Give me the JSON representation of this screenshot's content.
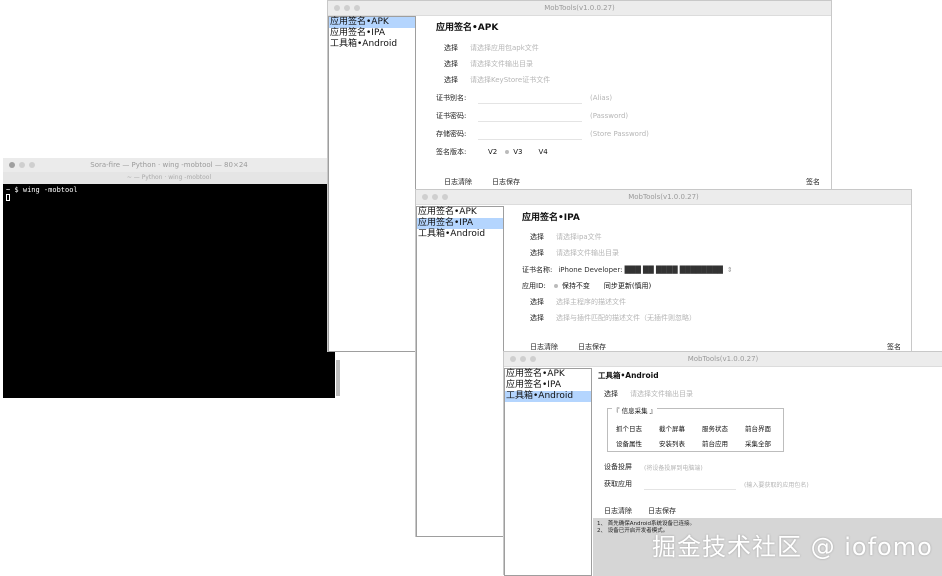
{
  "terminal": {
    "title": "Sora-fire — Python · wing -mobtool — 80×24",
    "subtitle": "~ — Python · wing -mobtool",
    "prompt": "~ $ wing -mobtool"
  },
  "sidebar_items": [
    "应用签名•APK",
    "应用签名•IPA",
    "工具箱•Android"
  ],
  "apk_window": {
    "title": "MobTools(v1.0.0.27)",
    "heading": "应用签名•APK",
    "rows": [
      {
        "button": "选择",
        "placeholder": "请选择应用包apk文件"
      },
      {
        "button": "选择",
        "placeholder": "请选择文件输出目录"
      },
      {
        "button": "选择",
        "placeholder": "请选择KeyStore证书文件"
      }
    ],
    "fields": [
      {
        "label": "证书别名:",
        "hint": "(Alias)"
      },
      {
        "label": "证书密码:",
        "hint": "(Password)"
      },
      {
        "label": "存储密码:",
        "hint": "(Store Password)"
      }
    ],
    "version_label": "签名版本:",
    "versions": [
      "V2",
      "V3",
      "V4"
    ],
    "clear_log": "日志清除",
    "save_log": "日志保存",
    "sign": "签名"
  },
  "ipa_window": {
    "title": "MobTools(v1.0.0.27)",
    "heading": "应用签名•IPA",
    "rows": [
      {
        "button": "选择",
        "placeholder": "请选择ipa文件"
      },
      {
        "button": "选择",
        "placeholder": "请选择文件输出目录"
      }
    ],
    "cert_label": "证书名称:",
    "cert_value": "iPhone Developer: ███ ██ ████ ████████",
    "appid_label": "应用ID:",
    "appid_options": [
      "保持不变",
      "同步更新(慎用)"
    ],
    "rows2": [
      {
        "button": "选择",
        "placeholder": "选择主程序的描述文件"
      },
      {
        "button": "选择",
        "placeholder": "选择与插件匹配的描述文件（无插件则忽略）"
      }
    ],
    "clear_log": "日志清除",
    "save_log": "日志保存",
    "sign": "签名"
  },
  "android_window": {
    "title": "MobTools(v1.0.0.27)",
    "heading": "工具箱•Android",
    "select": "选择",
    "select_placeholder": "请选择文件输出目录",
    "group_title": "『 信息采集 』",
    "grid": [
      "抓个日志",
      "截个屏幕",
      "服务状态",
      "前台界面",
      "设备属性",
      "安装列表",
      "前台应用",
      "采集全部"
    ],
    "mirror_label": "设备投屏",
    "mirror_hint": "(将设备投屏到电脑端)",
    "getapp_label": "获取应用",
    "getapp_hint": "(输入要获取的应用包名)",
    "clear_log": "日志清除",
    "save_log": "日志保存",
    "log_lines": [
      "1、 首先确保Android系统设备已连接。",
      "2、 设备已开启开发者模式。"
    ]
  },
  "watermark": "掘金技术社区 @ iofomo"
}
